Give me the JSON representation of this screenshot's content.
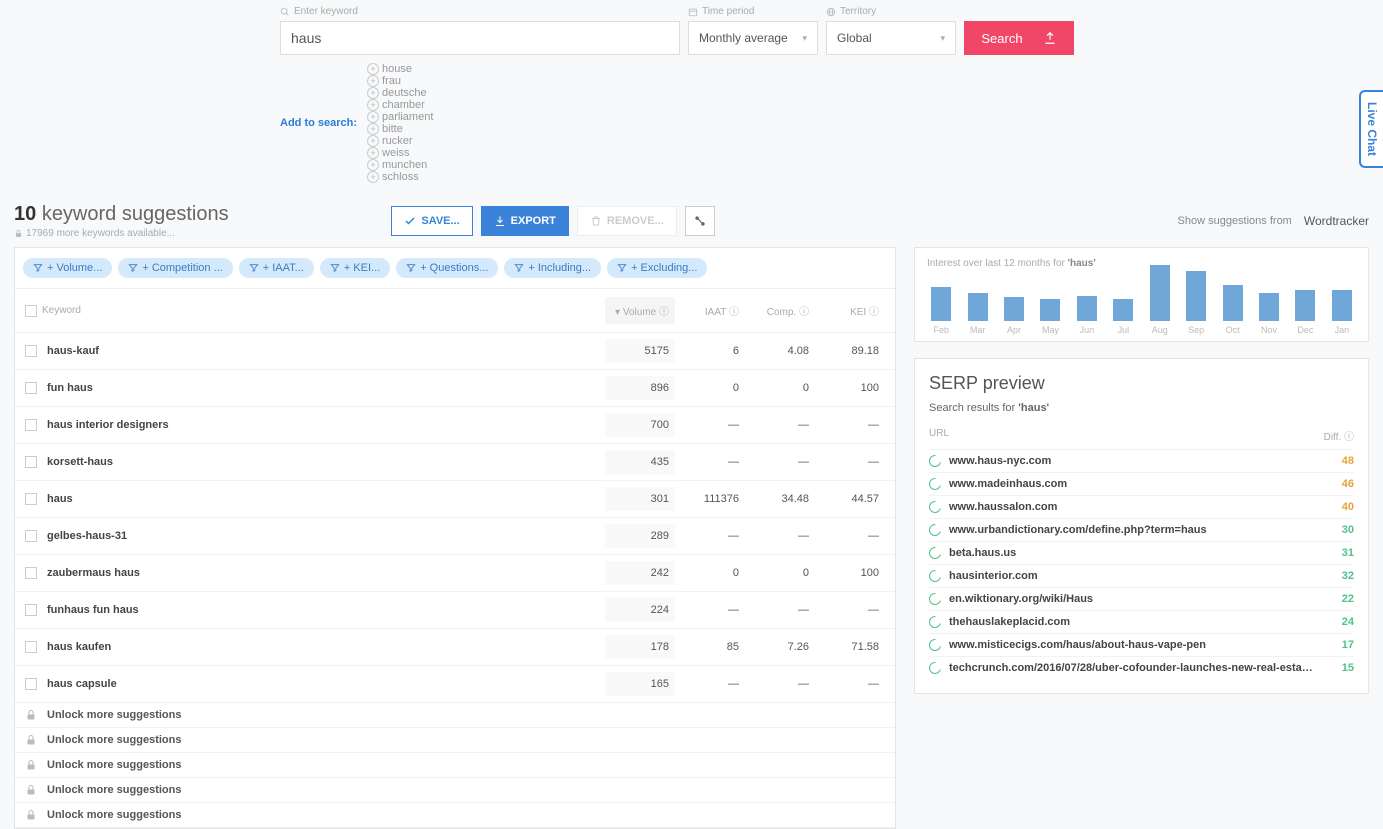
{
  "search": {
    "keyword_label": "Enter keyword",
    "time_label": "Time period",
    "territory_label": "Territory",
    "keyword_value": "haus",
    "time_value": "Monthly average",
    "territory_value": "Global",
    "search_btn": "Search",
    "add_label": "Add to search:",
    "suggestions": [
      "house",
      "frau",
      "deutsche",
      "chamber",
      "parliament",
      "bitte",
      "rucker",
      "weiss",
      "munchen",
      "schloss"
    ]
  },
  "header": {
    "count": "10",
    "title_rest": "keyword suggestions",
    "sub": "17969 more keywords available...",
    "save_btn": "SAVE...",
    "export_btn": "EXPORT",
    "remove_btn": "REMOVE...",
    "show_from": "Show suggestions from",
    "brand": "Wordtracker"
  },
  "filters": [
    "+ Volume...",
    "+ Competition ...",
    "+ IAAT...",
    "+ KEI...",
    "+ Questions...",
    "+ Including...",
    "+ Excluding..."
  ],
  "table": {
    "head_kw": "Keyword",
    "head_vol": "Volume",
    "head_iaat": "IAAT",
    "head_comp": "Comp.",
    "head_kei": "KEI",
    "rows": [
      {
        "kw": "haus-kauf",
        "vol": "5175",
        "iaat": "6",
        "comp": "4.08",
        "kei": "89.18"
      },
      {
        "kw": "fun haus",
        "vol": "896",
        "iaat": "0",
        "comp": "0",
        "kei": "100"
      },
      {
        "kw": "haus interior designers",
        "vol": "700",
        "iaat": "—",
        "comp": "—",
        "kei": "—"
      },
      {
        "kw": "korsett-haus",
        "vol": "435",
        "iaat": "—",
        "comp": "—",
        "kei": "—"
      },
      {
        "kw": "haus",
        "vol": "301",
        "iaat": "111376",
        "comp": "34.48",
        "kei": "44.57"
      },
      {
        "kw": "gelbes-haus-31",
        "vol": "289",
        "iaat": "—",
        "comp": "—",
        "kei": "—"
      },
      {
        "kw": "zaubermaus haus",
        "vol": "242",
        "iaat": "0",
        "comp": "0",
        "kei": "100"
      },
      {
        "kw": "funhaus fun haus",
        "vol": "224",
        "iaat": "—",
        "comp": "—",
        "kei": "—"
      },
      {
        "kw": "haus kaufen",
        "vol": "178",
        "iaat": "85",
        "comp": "7.26",
        "kei": "71.58"
      },
      {
        "kw": "haus capsule",
        "vol": "165",
        "iaat": "—",
        "comp": "—",
        "kei": "—"
      }
    ],
    "locked_text": "Unlock more suggestions",
    "locked_count": 5
  },
  "chart_data": {
    "type": "bar",
    "title_prefix": "Interest over last 12 months for ",
    "title_term": "'haus'",
    "categories": [
      "Feb",
      "Mar",
      "Apr",
      "May",
      "Jun",
      "Jul",
      "Aug",
      "Sep",
      "Oct",
      "Nov",
      "Dec",
      "Jan"
    ],
    "values": [
      60,
      50,
      42,
      40,
      45,
      40,
      100,
      90,
      65,
      50,
      55,
      55
    ],
    "ylim": [
      0,
      100
    ]
  },
  "serp": {
    "title": "SERP preview",
    "sub_prefix": "Search results for ",
    "sub_term": "'haus'",
    "head_url": "URL",
    "head_diff": "Diff.",
    "rows": [
      {
        "url": "www.haus-nyc.com",
        "diff": "48",
        "cls": "orange"
      },
      {
        "url": "www.madeinhaus.com",
        "diff": "46",
        "cls": "orange"
      },
      {
        "url": "www.haussalon.com",
        "diff": "40",
        "cls": "orange"
      },
      {
        "url": "www.urbandictionary.com/define.php?term=haus",
        "diff": "30",
        "cls": "green"
      },
      {
        "url": "beta.haus.us",
        "diff": "31",
        "cls": "green"
      },
      {
        "url": "hausinterior.com",
        "diff": "32",
        "cls": "green"
      },
      {
        "url": "en.wiktionary.org/wiki/Haus",
        "diff": "22",
        "cls": "green"
      },
      {
        "url": "thehauslakeplacid.com",
        "diff": "24",
        "cls": "green"
      },
      {
        "url": "www.misticecigs.com/haus/about-haus-vape-pen",
        "diff": "17",
        "cls": "green"
      },
      {
        "url": "techcrunch.com/2016/07/28/uber-cofounder-launches-new-real-estat...",
        "diff": "15",
        "cls": "green"
      }
    ]
  },
  "live_chat": "Live Chat"
}
